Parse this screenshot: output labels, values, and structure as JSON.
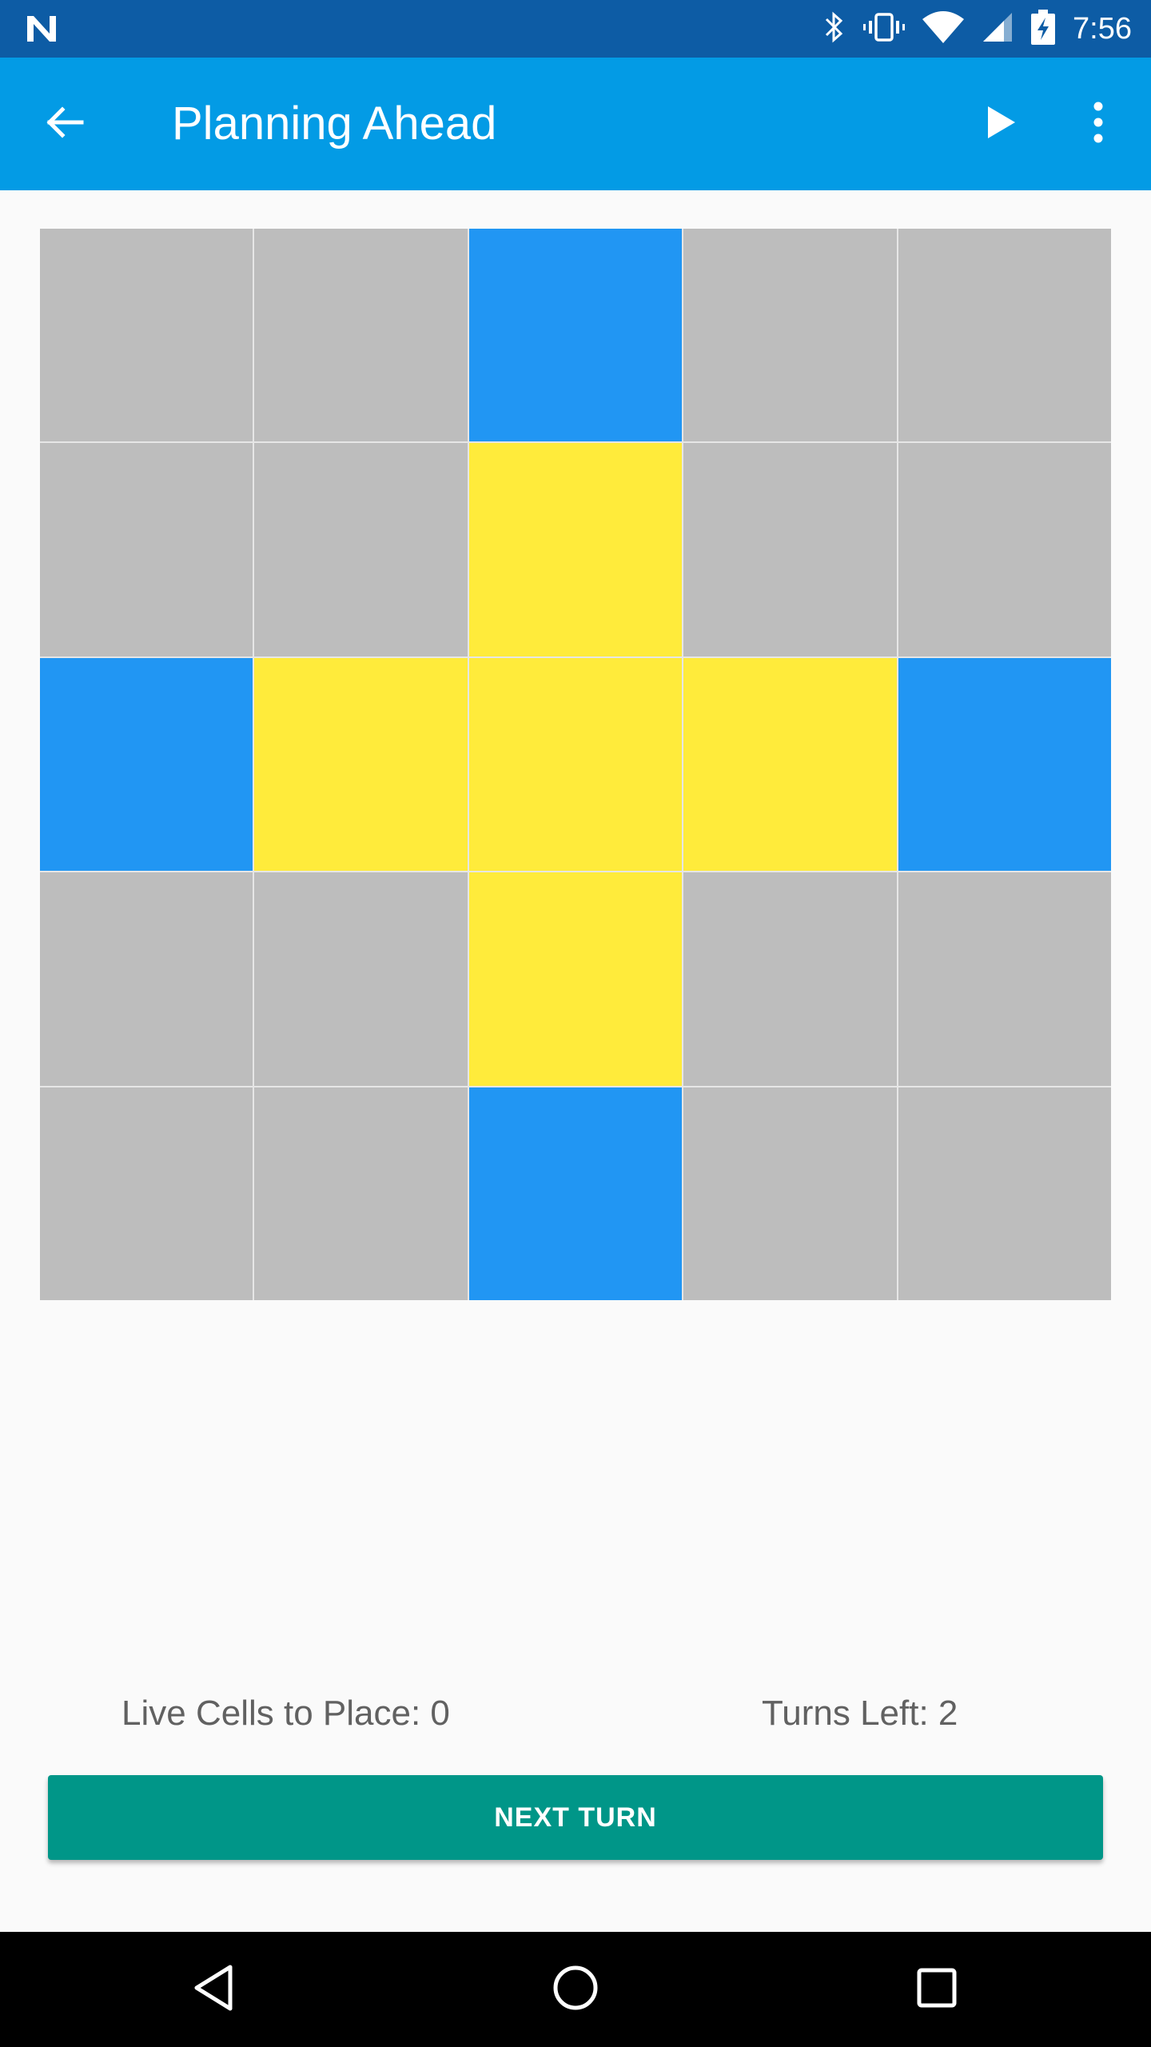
{
  "status_bar": {
    "time": "7:56",
    "icons": [
      "n-logo-icon",
      "bluetooth-icon",
      "vibrate-icon",
      "wifi-icon",
      "cellular-signal-icon",
      "battery-charging-icon"
    ],
    "background": "#0D5CA5"
  },
  "app_bar": {
    "title": "Planning Ahead",
    "background": "#039BE5",
    "actions": [
      "back-arrow-icon",
      "play-icon",
      "more-vert-icon"
    ]
  },
  "board": {
    "rows": 5,
    "columns": 5,
    "legend_colors": {
      "dead": "#BDBDBD",
      "live": "#FFEB3B",
      "next": "#2196F3"
    },
    "cells": [
      [
        "dead",
        "dead",
        "next",
        "dead",
        "dead"
      ],
      [
        "dead",
        "dead",
        "live",
        "dead",
        "dead"
      ],
      [
        "next",
        "live",
        "live",
        "live",
        "next"
      ],
      [
        "dead",
        "dead",
        "live",
        "dead",
        "dead"
      ],
      [
        "dead",
        "dead",
        "next",
        "dead",
        "dead"
      ]
    ]
  },
  "stats": {
    "live_cells_label": "Live Cells to Place: 0",
    "turns_left_label": "Turns Left: 2"
  },
  "actions": {
    "next_turn_label": "NEXT TURN",
    "next_turn_color": "#009688"
  },
  "nav_bar": {
    "buttons": [
      "nav-back-icon",
      "nav-home-icon",
      "nav-recents-icon"
    ]
  }
}
